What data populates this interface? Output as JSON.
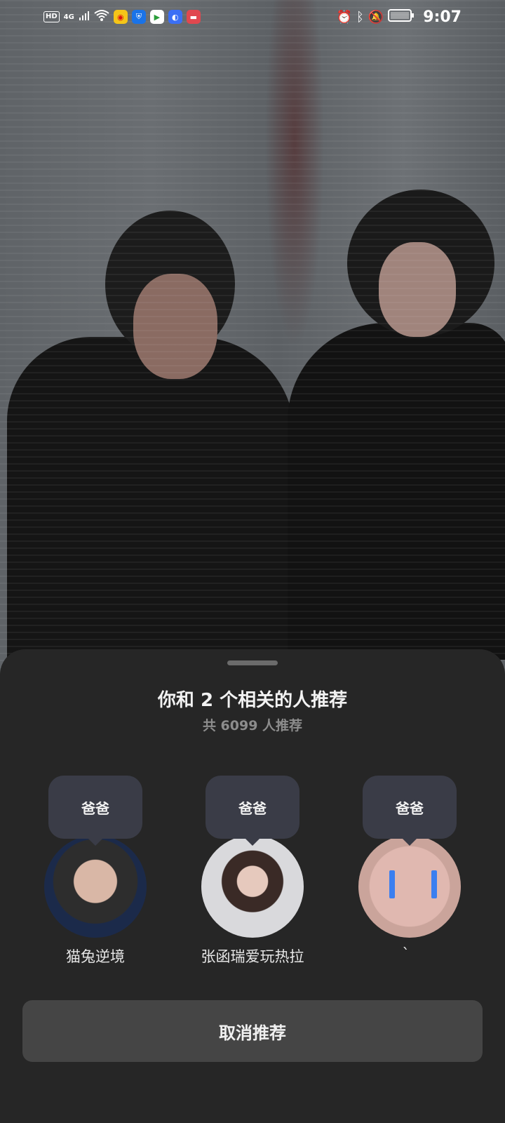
{
  "status_bar": {
    "hd": "HD",
    "network": "4G",
    "time": "9:07",
    "icons_left": [
      "hd-icon",
      "signal-icon",
      "wifi-icon",
      "weibo-icon",
      "shield-app-icon",
      "video-app-icon",
      "browser-app-icon",
      "red-app-icon"
    ],
    "icons_right": [
      "alarm-icon",
      "bluetooth-icon",
      "mute-icon",
      "battery-icon"
    ]
  },
  "sheet": {
    "title": "你和 2 个相关的人推荐",
    "subtitle": "共 6099 人推荐",
    "people": [
      {
        "relation": "爸爸",
        "name": "猫兔逆境"
      },
      {
        "relation": "爸爸",
        "name": "张函瑞爱玩热拉"
      },
      {
        "relation": "爸爸",
        "name": "̀"
      }
    ],
    "cancel_label": "取消推荐"
  },
  "colors": {
    "sheet_bg": "#262626",
    "bubble_bg": "#3a3c47",
    "button_bg": "#454545"
  }
}
